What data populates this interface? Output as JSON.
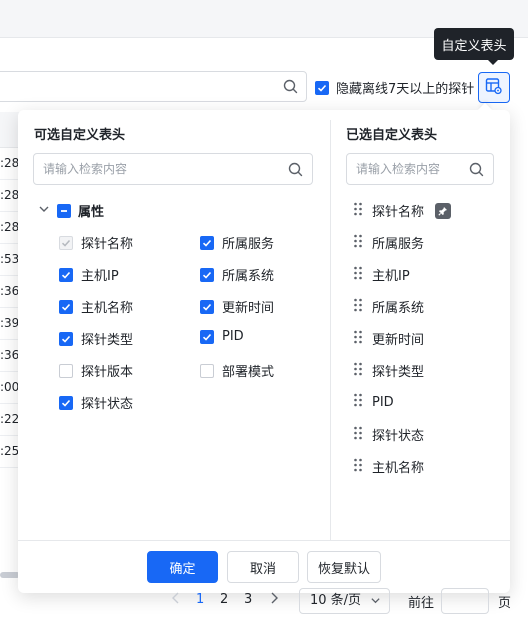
{
  "tooltip": "自定义表头",
  "hide_offline": {
    "label": "隐藏离线7天以上的探针",
    "checked": true
  },
  "table_bg": {
    "cells": [
      ":28",
      ":28",
      ":28",
      ":53",
      ":36",
      ":39",
      ":36",
      ":00",
      ":22",
      ":25"
    ]
  },
  "panel": {
    "left": {
      "title": "可选自定义表头",
      "search_placeholder": "请输入检索内容",
      "group": {
        "label": "属性",
        "state": "indeterminate"
      },
      "options": [
        {
          "label": "探针名称",
          "state": "disabled-checked"
        },
        {
          "label": "所属服务",
          "state": "checked"
        },
        {
          "label": "主机IP",
          "state": "checked"
        },
        {
          "label": "所属系统",
          "state": "checked"
        },
        {
          "label": "主机名称",
          "state": "checked"
        },
        {
          "label": "更新时间",
          "state": "checked"
        },
        {
          "label": "探针类型",
          "state": "checked"
        },
        {
          "label": "PID",
          "state": "checked"
        },
        {
          "label": "探针版本",
          "state": "unchecked"
        },
        {
          "label": "部署模式",
          "state": "unchecked"
        },
        {
          "label": "探针状态",
          "state": "checked"
        }
      ]
    },
    "right": {
      "title": "已选自定义表头",
      "search_placeholder": "请输入检索内容",
      "items": [
        {
          "label": "探针名称",
          "pinned": true
        },
        {
          "label": "所属服务"
        },
        {
          "label": "主机IP"
        },
        {
          "label": "所属系统"
        },
        {
          "label": "更新时间"
        },
        {
          "label": "探针类型"
        },
        {
          "label": "PID"
        },
        {
          "label": "探针状态"
        },
        {
          "label": "主机名称"
        }
      ]
    },
    "footer": {
      "confirm": "确定",
      "cancel": "取消",
      "reset": "恢复默认"
    }
  },
  "pagination": {
    "pages": [
      "1",
      "2",
      "3"
    ],
    "current": "1",
    "page_size": "10 条/页",
    "goto_label": "前往",
    "page_suffix": "页"
  },
  "colors": {
    "accent": "#1868f5",
    "tooltip_bg": "#1f2329",
    "text": "#1f2329",
    "muted": "#9aa0a8"
  }
}
